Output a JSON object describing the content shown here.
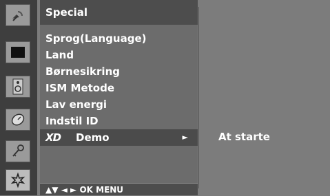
{
  "sidebar": {
    "icons": [
      {
        "name": "satellite-icon",
        "selected": false
      },
      {
        "name": "picture-icon",
        "selected": false
      },
      {
        "name": "speaker-icon",
        "selected": false
      },
      {
        "name": "clock-icon",
        "selected": false
      },
      {
        "name": "key-icon",
        "selected": false
      },
      {
        "name": "settings-icon",
        "selected": true
      }
    ]
  },
  "menu": {
    "title": "Special",
    "items": [
      {
        "label": "Sprog(Language)"
      },
      {
        "label": "Land"
      },
      {
        "label": "Børnesikring"
      },
      {
        "label": "ISM Metode"
      },
      {
        "label": "Lav energi"
      },
      {
        "label": "Indstil ID"
      }
    ],
    "demo": {
      "logo": "XD",
      "label": "Demo",
      "arrow": "►"
    },
    "footer": "▲▼ ◄ ► OK  MENU"
  },
  "submenu": {
    "text": "At starte"
  }
}
